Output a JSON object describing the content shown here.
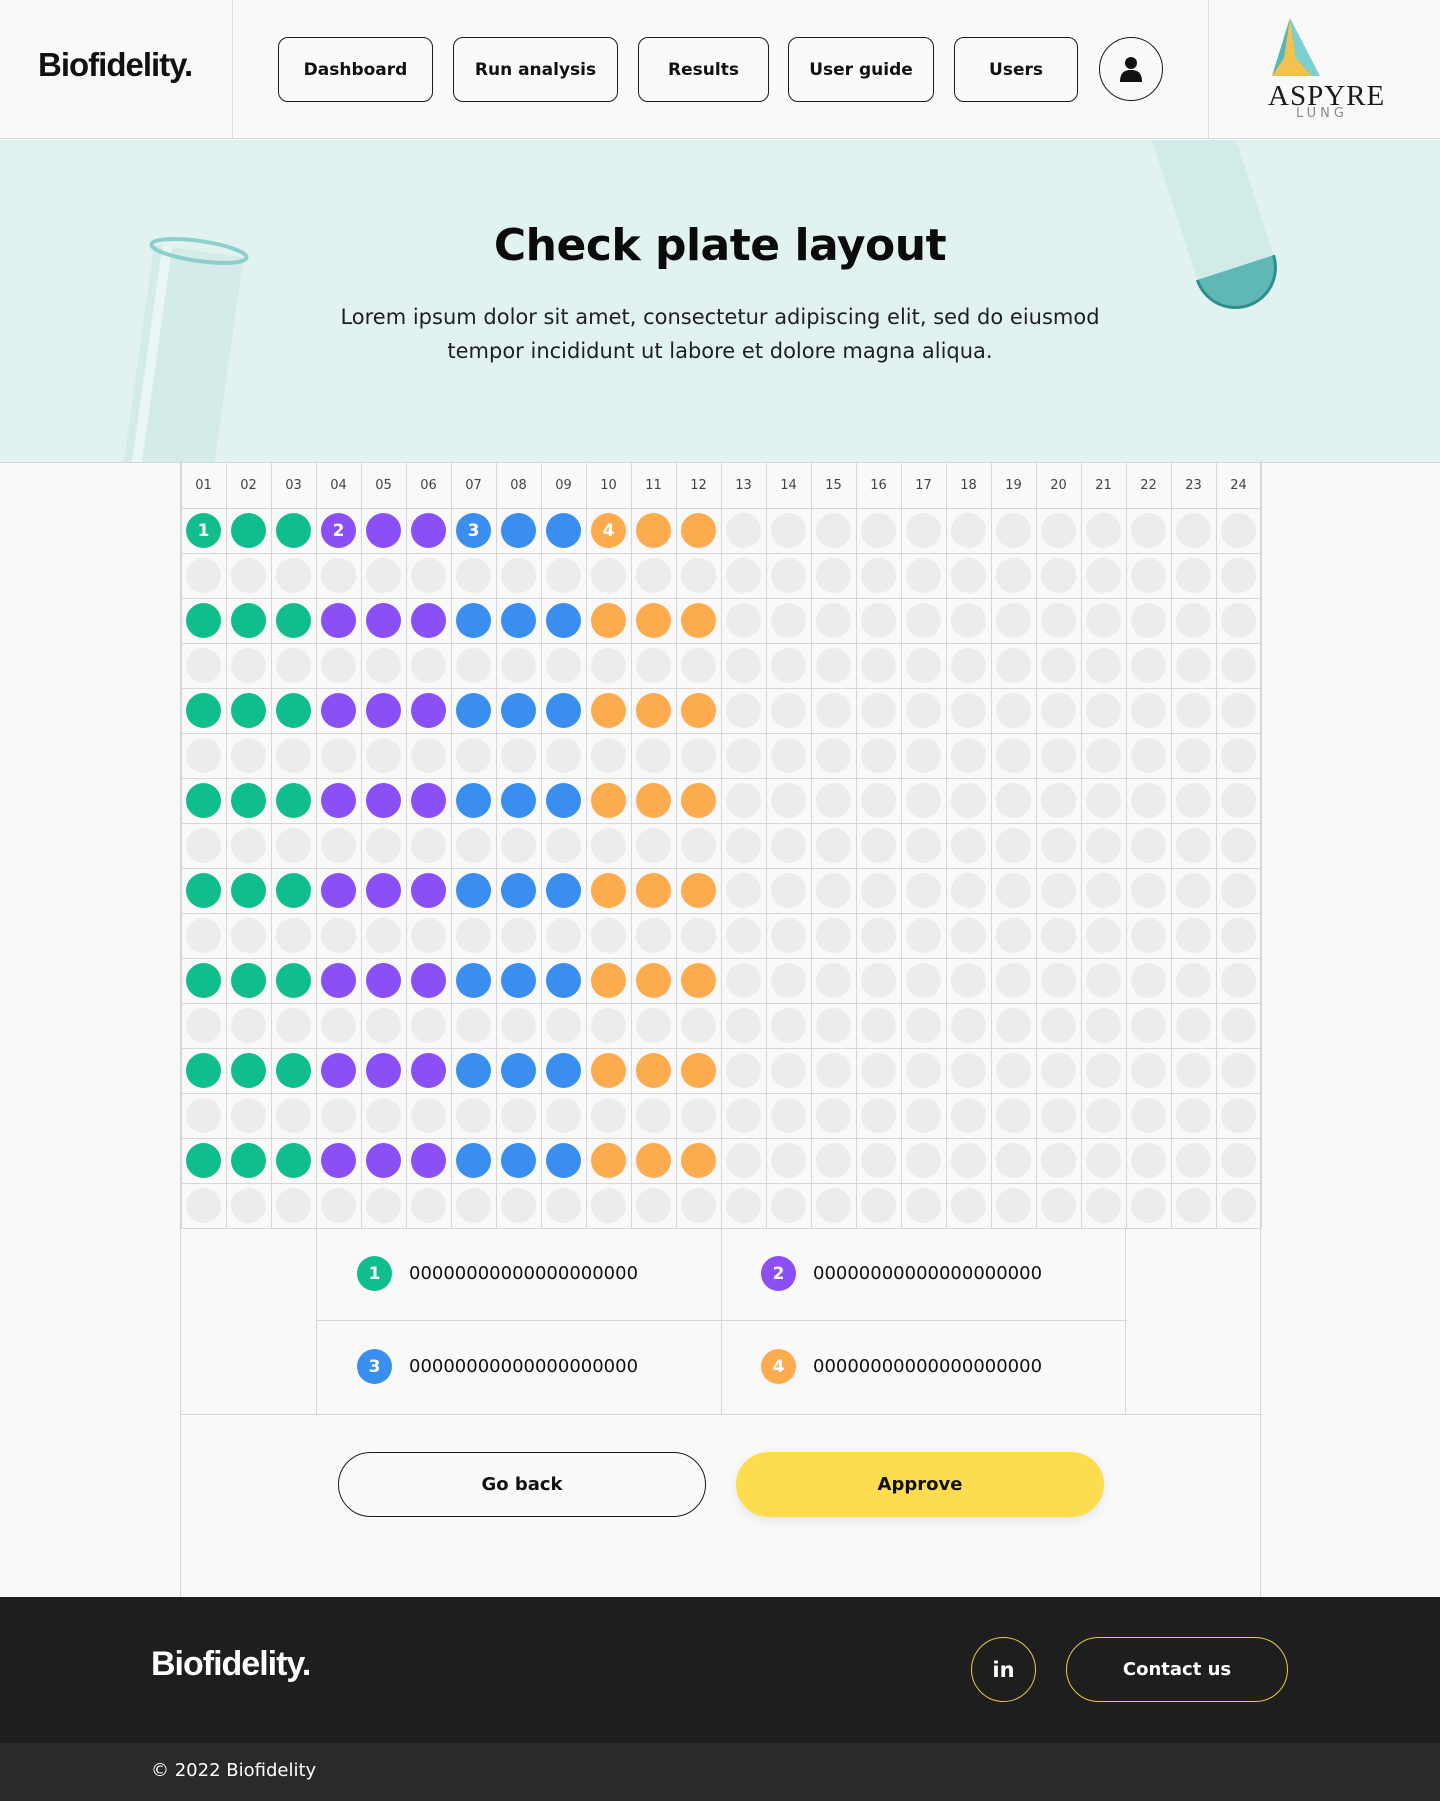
{
  "header": {
    "brand": "Biofidelity.",
    "nav": [
      {
        "label": "Dashboard",
        "name": "nav-dashboard-button"
      },
      {
        "label": "Run analysis",
        "name": "nav-run-analysis-button"
      },
      {
        "label": "Results",
        "name": "nav-results-button"
      },
      {
        "label": "User guide",
        "name": "nav-user-guide-button"
      },
      {
        "label": "Users",
        "name": "nav-users-button"
      }
    ],
    "user_icon": "user-icon",
    "partner_logo": {
      "name": "ASPYRE",
      "sub": "LUNG",
      "colors": [
        "#2fa7a7",
        "#7ecfd1",
        "#f2c14e"
      ]
    }
  },
  "hero": {
    "title": "Check plate layout",
    "description": "Lorem ipsum dolor sit amet, consectetur adipiscing elit, sed do eiusmod tempor incididunt ut labore et dolore magna aliqua."
  },
  "plate": {
    "columns": [
      "01",
      "02",
      "03",
      "04",
      "05",
      "06",
      "07",
      "08",
      "09",
      "10",
      "11",
      "12",
      "13",
      "14",
      "15",
      "16",
      "17",
      "18",
      "19",
      "20",
      "21",
      "22",
      "23",
      "24"
    ],
    "row_count": 16,
    "filled_rows": [
      0,
      2,
      4,
      6,
      8,
      10,
      12,
      14
    ],
    "groups": [
      {
        "id": "1",
        "color": "#10bd8c",
        "columns": [
          0,
          1,
          2
        ]
      },
      {
        "id": "2",
        "color": "#8a4ff5",
        "columns": [
          3,
          4,
          5
        ]
      },
      {
        "id": "3",
        "color": "#3a8ef0",
        "columns": [
          6,
          7,
          8
        ]
      },
      {
        "id": "4",
        "color": "#fdab4f",
        "columns": [
          9,
          10,
          11
        ]
      }
    ],
    "empty_color": "#ececec"
  },
  "legend": [
    {
      "id": "1",
      "label": "00000000000000000000",
      "color": "#10bd8c"
    },
    {
      "id": "2",
      "label": "00000000000000000000",
      "color": "#8a4ff5"
    },
    {
      "id": "3",
      "label": "00000000000000000000",
      "color": "#3a8ef0"
    },
    {
      "id": "4",
      "label": "00000000000000000000",
      "color": "#fdab4f"
    }
  ],
  "actions": {
    "back_label": "Go back",
    "approve_label": "Approve"
  },
  "footer": {
    "brand": "Biofidelity.",
    "linkedin_label": "in",
    "contact_label": "Contact us",
    "copyright": "© 2022 Biofidelity"
  }
}
